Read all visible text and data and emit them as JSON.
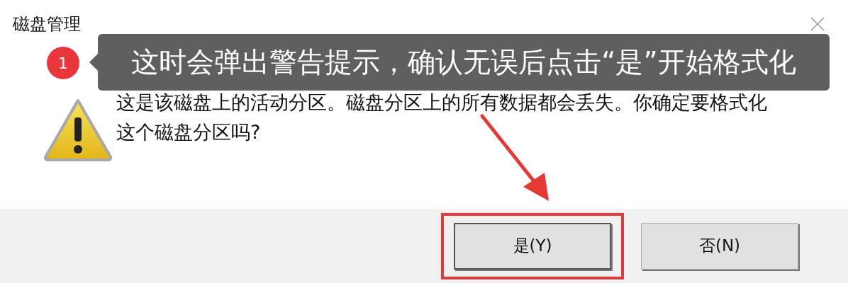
{
  "window": {
    "title": "磁盘管理"
  },
  "annotation": {
    "step": "1",
    "text": "这时会弹出警告提示，确认无误后点击“是”开始格式化"
  },
  "message": "这是该磁盘上的活动分区。磁盘分区上的所有数据都会丢失。你确定要格式化这个磁盘分区吗?",
  "buttons": [
    {
      "label": "是(Y)",
      "default": true,
      "highlighted": true
    },
    {
      "label": "否(N)",
      "default": false,
      "highlighted": false
    }
  ]
}
